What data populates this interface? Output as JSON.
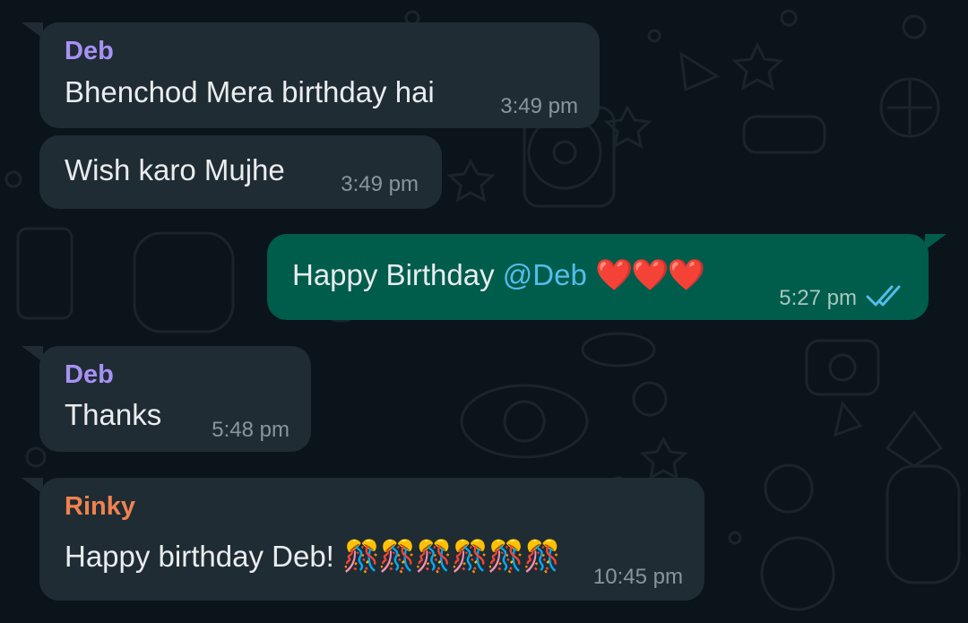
{
  "theme": {
    "background": "#0b141a",
    "incoming_bubble": "#202c33",
    "outgoing_bubble": "#005c4b",
    "mention_color": "#53bdeb",
    "read_tick_color": "#53bdeb",
    "sender_colors": {
      "Deb": "#a791f5",
      "Rinky": "#f0824f"
    }
  },
  "messages": [
    {
      "direction": "incoming",
      "sender": "Deb",
      "text": "Bhenchod Mera birthday hai",
      "time": "3:49 pm"
    },
    {
      "direction": "incoming",
      "text": "Wish karo Mujhe",
      "time": "3:49 pm"
    },
    {
      "direction": "outgoing",
      "text": "Happy Birthday ",
      "mention": "@Deb",
      "emoji": "❤️❤️❤️",
      "time": "5:27 pm",
      "status_icon": "double-check-read-icon"
    },
    {
      "direction": "incoming",
      "sender": "Deb",
      "text": "Thanks",
      "time": "5:48 pm"
    },
    {
      "direction": "incoming",
      "sender": "Rinky",
      "text": "Happy birthday Deb! ",
      "emoji": "🎊🎊🎊🎊🎊🎊",
      "time": "10:45 pm"
    }
  ]
}
